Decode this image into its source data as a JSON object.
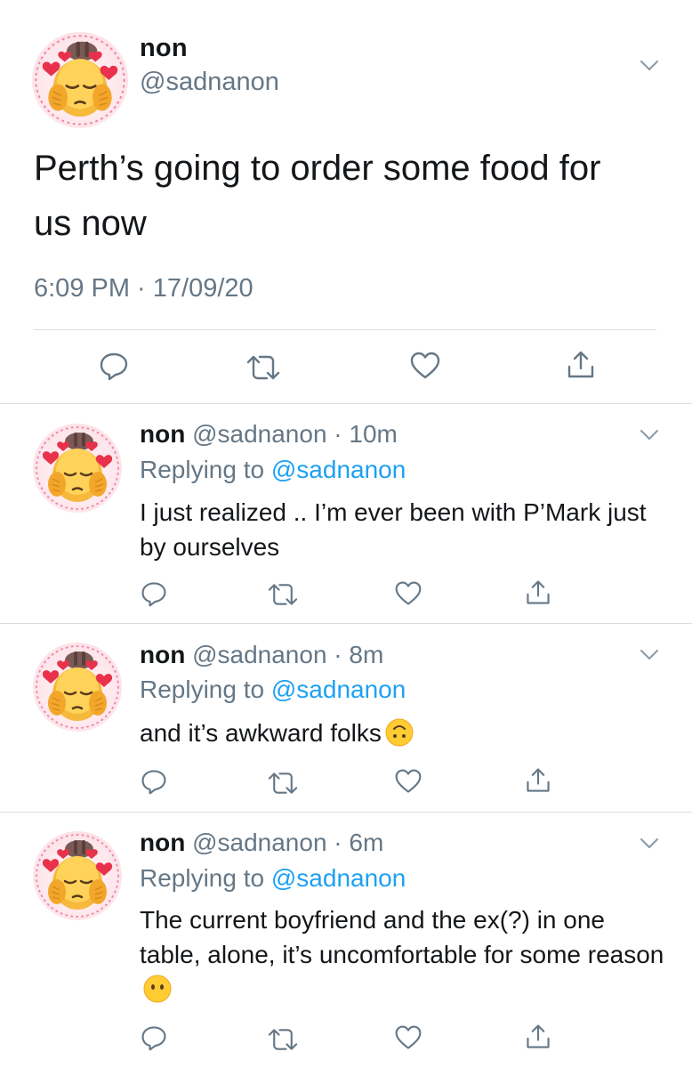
{
  "main_tweet": {
    "display_name": "non",
    "handle": "@sadnanon",
    "text": "Perth’s going to order some food for us now",
    "timestamp": "6:09 PM · 17/09/20",
    "avatar": "blushing-emoji-avatar",
    "actions": [
      "reply-icon",
      "retweet-icon",
      "like-icon",
      "share-icon"
    ]
  },
  "replies": [
    {
      "display_name": "non",
      "handle_time": "@sadnanon · 10m",
      "replying_prefix": "Replying to ",
      "replying_to": "@sadnanon",
      "text": "I just realized .. I’m ever been with P’Mark just by ourselves",
      "emoji": ""
    },
    {
      "display_name": "non",
      "handle_time": "@sadnanon · 8m",
      "replying_prefix": "Replying to ",
      "replying_to": "@sadnanon",
      "text": "and it’s awkward folks",
      "emoji": "upside-down-face-icon"
    },
    {
      "display_name": "non",
      "handle_time": "@sadnanon · 6m",
      "replying_prefix": "Replying to ",
      "replying_to": "@sadnanon",
      "text": "The current boyfriend and the ex(?) in one table, alone, it’s uncomfortable for some reason",
      "emoji": "no-mouth-face-icon"
    }
  ],
  "colors": {
    "text": "#14171a",
    "secondary": "#657786",
    "link": "#1da1f2",
    "divider": "#d9dde1"
  }
}
